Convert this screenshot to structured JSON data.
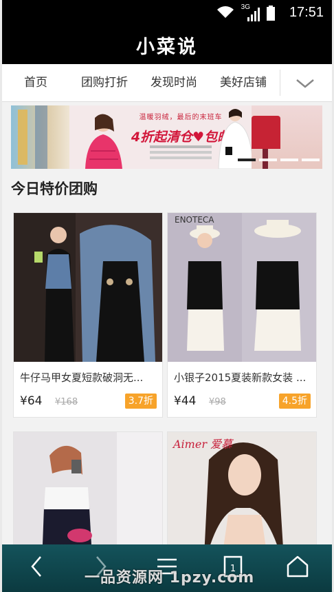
{
  "status_bar": {
    "time": "17:51",
    "network": "3G",
    "icons": [
      "wifi-icon",
      "signal-icon",
      "battery-icon"
    ]
  },
  "app": {
    "title": "小菜说"
  },
  "nav": {
    "tabs": [
      {
        "label": "首页"
      },
      {
        "label": "团购打折"
      },
      {
        "label": "发现时尚"
      },
      {
        "label": "美好店铺"
      }
    ],
    "more_icon": "chevron-down-icon"
  },
  "banner": {
    "promo_line": "温暖羽绒，最后的末班车",
    "headline": "4折起清仓♥包邮",
    "slide_count": 4,
    "active_slide": 1
  },
  "section": {
    "title": "今日特价团购"
  },
  "products": [
    {
      "name": "牛仔马甲女夏短款破洞无...",
      "price": "¥64",
      "original_price": "¥168",
      "discount": "3.7折"
    },
    {
      "name": "小银子2015夏装新款女装 ...",
      "price": "¥44",
      "original_price": "¥98",
      "discount": "4.5折"
    },
    {
      "name": "",
      "price": "",
      "original_price": "",
      "discount": "",
      "brand_mark": "Aimer 爱慕"
    },
    {
      "name": "",
      "price": "",
      "original_price": "",
      "discount": ""
    }
  ],
  "toolbar": {
    "buttons": [
      "back-icon",
      "forward-icon",
      "menu-icon",
      "tabs-icon",
      "home-icon"
    ],
    "tab_count": "1"
  },
  "watermark": "一品资源网 1pzy.com",
  "colors": {
    "header_bg": "#000000",
    "badge": "#f7a32a",
    "toolbar": "#0f4a51",
    "page_bg": "#f2f2f2"
  }
}
